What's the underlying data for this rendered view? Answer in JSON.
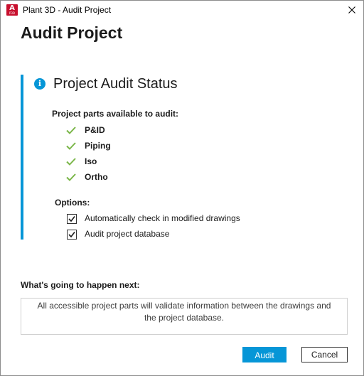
{
  "window": {
    "title": "Plant 3D - Audit Project",
    "app_icon_letter": "A",
    "app_icon_sub": "P3D",
    "app_icon": "autocad-plant3d-icon",
    "close_icon": "close-icon"
  },
  "header": {
    "title": "Audit Project"
  },
  "status": {
    "heading": "Project Audit Status",
    "info_icon_glyph": "i",
    "parts_label": "Project parts available to audit:",
    "parts": [
      {
        "label": "P&ID",
        "checked": true
      },
      {
        "label": "Piping",
        "checked": true
      },
      {
        "label": "Iso",
        "checked": true
      },
      {
        "label": "Ortho",
        "checked": true
      }
    ],
    "options_label": "Options:",
    "options": [
      {
        "label": "Automatically check in modified drawings",
        "checked": true
      },
      {
        "label": "Audit project database",
        "checked": true
      }
    ]
  },
  "next": {
    "label": "What's going to happen next:",
    "text": "All accessible project parts will validate information between the drawings and the project database."
  },
  "buttons": {
    "primary_label": "Audit",
    "secondary_label": "Cancel"
  },
  "colors": {
    "accent": "#0696d7",
    "check_green": "#7ab648",
    "app_icon_red": "#c8102e"
  }
}
